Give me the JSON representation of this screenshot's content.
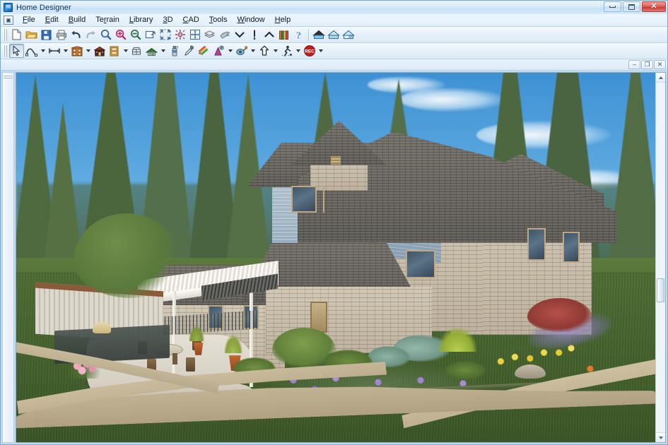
{
  "window": {
    "title": "Home Designer",
    "app_icon": "app-logo-icon",
    "controls": {
      "minimize": "minimize-icon",
      "maximize": "maximize-icon",
      "close": "close-icon"
    }
  },
  "mdi_child": {
    "controls": {
      "minimize": "–",
      "restore": "❐",
      "close": "✕"
    }
  },
  "menubar": {
    "system_icon": "document-system-menu-icon",
    "items": [
      {
        "label": "File",
        "mnemonic": "F"
      },
      {
        "label": "Edit",
        "mnemonic": "E"
      },
      {
        "label": "Build",
        "mnemonic": "B"
      },
      {
        "label": "Terrain",
        "mnemonic": "r"
      },
      {
        "label": "Library",
        "mnemonic": "L"
      },
      {
        "label": "3D",
        "mnemonic": "3"
      },
      {
        "label": "CAD",
        "mnemonic": "C"
      },
      {
        "label": "Tools",
        "mnemonic": "T"
      },
      {
        "label": "Window",
        "mnemonic": "W"
      },
      {
        "label": "Help",
        "mnemonic": "H"
      }
    ]
  },
  "toolbar_top": {
    "items": [
      {
        "name": "gripper",
        "type": "gripper"
      },
      {
        "name": "new-plan-button",
        "icon": "new-document-icon",
        "tooltip": "New Plan"
      },
      {
        "name": "open-plan-button",
        "icon": "open-folder-icon",
        "tooltip": "Open Plan"
      },
      {
        "name": "save-plan-button",
        "icon": "save-disk-icon",
        "tooltip": "Save Plan"
      },
      {
        "name": "print-button",
        "icon": "printer-icon",
        "tooltip": "Print"
      },
      {
        "name": "undo-button",
        "icon": "undo-arrow-icon",
        "tooltip": "Undo"
      },
      {
        "name": "redo-button",
        "icon": "redo-arrow-icon",
        "tooltip": "Redo"
      },
      {
        "name": "zoom-button",
        "icon": "magnifier-icon",
        "tooltip": "Zoom"
      },
      {
        "name": "zoom-in-button",
        "icon": "zoom-in-icon",
        "tooltip": "Zoom In"
      },
      {
        "name": "zoom-out-button",
        "icon": "zoom-out-icon",
        "tooltip": "Zoom Out"
      },
      {
        "name": "fill-window-button",
        "icon": "fill-window-icon",
        "tooltip": "Fill Window"
      },
      {
        "name": "fill-window-building-button",
        "icon": "expand-arrows-icon",
        "tooltip": "Fill Window Building Only"
      },
      {
        "name": "zoom-extents-button",
        "icon": "zoom-extents-icon",
        "tooltip": "Zoom Extents"
      },
      {
        "name": "pan-button",
        "icon": "pan-move-icon",
        "tooltip": "Pan Window"
      },
      {
        "name": "floor-down-button",
        "icon": "floor-layers-icon",
        "tooltip": "Down One Floor"
      },
      {
        "name": "reference-display-button",
        "icon": "reference-hand-icon",
        "tooltip": "Reference Display"
      },
      {
        "name": "down-one-floor-button",
        "icon": "chevron-down-icon",
        "tooltip": "Down One Floor"
      },
      {
        "name": "current-floor-button",
        "icon": "exclamation-icon",
        "tooltip": "Current Floor"
      },
      {
        "name": "up-one-floor-button",
        "icon": "chevron-up-icon",
        "tooltip": "Up One Floor"
      },
      {
        "name": "library-browser-button",
        "icon": "library-books-icon",
        "tooltip": "Library Browser"
      },
      {
        "name": "help-button",
        "icon": "help-question-icon",
        "tooltip": "Help"
      },
      {
        "name": "separator",
        "type": "separator"
      },
      {
        "name": "full-overview-button",
        "icon": "house-overview-icon",
        "tooltip": "Full Overview"
      },
      {
        "name": "framing-overview-button",
        "icon": "house-framing-icon",
        "tooltip": "Framing Overview"
      },
      {
        "name": "wall-elevation-button",
        "icon": "house-elevation-icon",
        "tooltip": "Wall Elevation"
      }
    ]
  },
  "toolbar_second": {
    "items": [
      {
        "name": "gripper",
        "type": "gripper"
      },
      {
        "name": "select-objects-button",
        "icon": "arrow-pointer-icon",
        "tooltip": "Select Objects",
        "active": true
      },
      {
        "name": "draw-curve-button",
        "icon": "curve-spline-icon",
        "tooltip": "Draw Curve",
        "dropdown": true
      },
      {
        "name": "dimension-button",
        "icon": "dimension-line-icon",
        "tooltip": "Dimensions",
        "dropdown": true
      },
      {
        "name": "exterior-wall-button",
        "icon": "building-wall-icon",
        "tooltip": "Exterior Wall",
        "dropdown": true
      },
      {
        "name": "foundation-button",
        "icon": "foundation-icon",
        "tooltip": "Foundation"
      },
      {
        "name": "door-button",
        "icon": "door-icon",
        "tooltip": "Doors",
        "dropdown": true
      },
      {
        "name": "window-button",
        "icon": "window-frame-icon",
        "tooltip": "Windows"
      },
      {
        "name": "roof-button",
        "icon": "roof-house-icon",
        "tooltip": "Build Roof",
        "dropdown": true
      },
      {
        "name": "spray-can-button",
        "icon": "spray-can-icon",
        "tooltip": "Material Painter"
      },
      {
        "name": "eyedropper-button",
        "icon": "eyedropper-icon",
        "tooltip": "Material Eyedropper"
      },
      {
        "name": "color-pencils-button",
        "icon": "color-pencils-icon",
        "tooltip": "Materials"
      },
      {
        "name": "paint-cone-button",
        "icon": "paint-cone-icon",
        "tooltip": "Material Painter",
        "dropdown": true
      },
      {
        "name": "camera-button",
        "icon": "camera-eye-icon",
        "tooltip": "Full Camera",
        "dropdown": true
      },
      {
        "name": "elevation-arrow-button",
        "icon": "up-arrow-icon",
        "tooltip": "Cross Section/Elevation",
        "dropdown": true
      },
      {
        "name": "walkthrough-button",
        "icon": "walkthrough-icon",
        "tooltip": "Walkthrough Path",
        "dropdown": true
      },
      {
        "name": "record-button",
        "icon": "record-rec-icon",
        "tooltip": "Record Walkthrough",
        "label": "REC",
        "dropdown": true
      }
    ]
  },
  "scrollbar": {
    "up_arrow": "scroll-up-arrow-icon",
    "down_arrow": "scroll-down-arrow-icon",
    "thumb": "scroll-thumb"
  },
  "viewport": {
    "name": "3d-render-viewport",
    "description": "3D rendered exterior view of a two-story craftsman style home with stone veneer and blue-gray lap siding, dark shingle roof, white pergola over a concrete patio with outdoor dining set, surrounded by conifer trees and a landscaped flower garden with purple, yellow and orange blooms, green lawn and a winding gravel path.",
    "scene_colors": {
      "sky_top": "#3d91d4",
      "sky_bottom": "#bcdff4",
      "roof_shingle": "#6e6a62",
      "siding": "#9fb3c3",
      "stone_veneer": "#c0b49f",
      "trim": "#bda883",
      "lawn": "#47652e",
      "path_gravel": "#c4b696",
      "patio_concrete": "#ded9cf",
      "pergola_white": "#f2f1ec",
      "flower_purple": "#8a6fc4",
      "flower_yellow": "#e0c132",
      "flower_orange": "#d4762e",
      "flower_pink": "#e79bb2",
      "conifer_green": "#4c6640",
      "shrub_bluegreen": "#7fa394",
      "japanese_maple_red": "#a8443c"
    }
  }
}
